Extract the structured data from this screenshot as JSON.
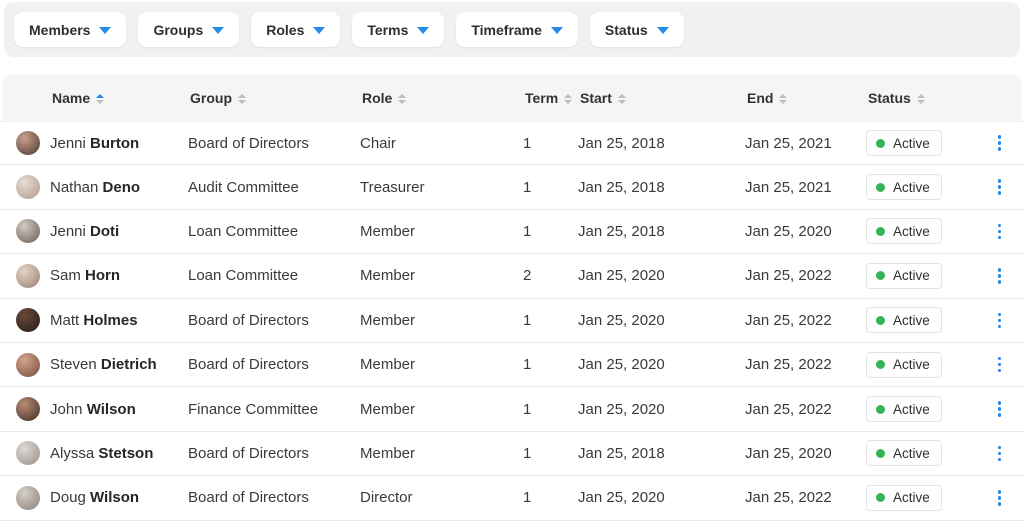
{
  "colors": {
    "accent": "#2589e9",
    "green": "#35b455"
  },
  "filters": [
    {
      "label": "Members"
    },
    {
      "label": "Groups"
    },
    {
      "label": "Roles"
    },
    {
      "label": "Terms"
    },
    {
      "label": "Timeframe"
    },
    {
      "label": "Status"
    }
  ],
  "table": {
    "columns": [
      {
        "label": "Name",
        "sorted": "asc"
      },
      {
        "label": "Group"
      },
      {
        "label": "Role"
      },
      {
        "label": "Term"
      },
      {
        "label": "Start"
      },
      {
        "label": "End"
      },
      {
        "label": "Status"
      }
    ],
    "rows": [
      {
        "first": "Jenni",
        "last": "Burton",
        "group": "Board of Directors",
        "role": "Chair",
        "term": "1",
        "start": "Jan 25, 2018",
        "end": "Jan 25, 2021",
        "status": "Active",
        "avatar": [
          "#c9a08c",
          "#4a3631"
        ]
      },
      {
        "first": "Nathan",
        "last": "Deno",
        "group": "Audit Committee",
        "role": "Treasurer",
        "term": "1",
        "start": "Jan 25, 2018",
        "end": "Jan 25, 2021",
        "status": "Active",
        "avatar": [
          "#e8dcd4",
          "#b09a8a"
        ]
      },
      {
        "first": "Jenni",
        "last": "Doti",
        "group": "Loan Committee",
        "role": "Member",
        "term": "1",
        "start": "Jan 25, 2018",
        "end": "Jan 25, 2020",
        "status": "Active",
        "avatar": [
          "#cfcac4",
          "#6b5a4d"
        ]
      },
      {
        "first": "Sam",
        "last": "Horn",
        "group": "Loan Committee",
        "role": "Member",
        "term": "2",
        "start": "Jan 25, 2020",
        "end": "Jan 25, 2022",
        "status": "Active",
        "avatar": [
          "#e3d3c6",
          "#9b7f6b"
        ]
      },
      {
        "first": "Matt",
        "last": "Holmes",
        "group": "Board of Directors",
        "role": "Member",
        "term": "1",
        "start": "Jan 25, 2020",
        "end": "Jan 25, 2022",
        "status": "Active",
        "avatar": [
          "#6b4a3a",
          "#241a16"
        ]
      },
      {
        "first": "Steven",
        "last": "Dietrich",
        "group": "Board of Directors",
        "role": "Member",
        "term": "1",
        "start": "Jan 25, 2020",
        "end": "Jan 25, 2022",
        "status": "Active",
        "avatar": [
          "#d0a58c",
          "#7a4a3a"
        ]
      },
      {
        "first": "John",
        "last": "Wilson",
        "group": "Finance Committee",
        "role": "Member",
        "term": "1",
        "start": "Jan 25, 2020",
        "end": "Jan 25, 2022",
        "status": "Active",
        "avatar": [
          "#b98d72",
          "#3c2b24"
        ]
      },
      {
        "first": "Alyssa",
        "last": "Stetson",
        "group": "Board of Directors",
        "role": "Member",
        "term": "1",
        "start": "Jan 25, 2018",
        "end": "Jan 25, 2020",
        "status": "Active",
        "avatar": [
          "#dcd9d6",
          "#9a8f85"
        ]
      },
      {
        "first": "Doug",
        "last": "Wilson",
        "group": "Board of Directors",
        "role": "Director",
        "term": "1",
        "start": "Jan 25, 2020",
        "end": "Jan 25, 2022",
        "status": "Active",
        "avatar": [
          "#d6cfc7",
          "#8a8078"
        ]
      }
    ]
  }
}
